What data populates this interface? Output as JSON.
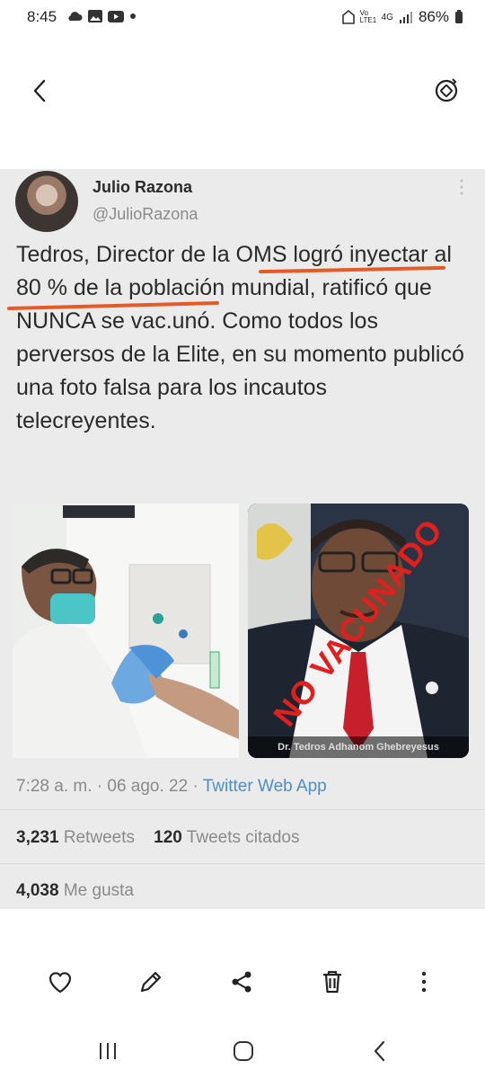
{
  "status_bar": {
    "time": "8:45",
    "network": "4G",
    "volte": "Vo LTE1",
    "battery": "86%"
  },
  "icons": {
    "back": "chevron-left-icon",
    "rotate": "rotate-icon",
    "like": "heart-icon",
    "edit": "pencil-icon",
    "share": "share-icon",
    "delete": "trash-icon",
    "more": "more-vertical-icon"
  },
  "tweet": {
    "author_name": "Julio Razona",
    "author_handle": "@JulioRazona",
    "text": "Tedros, Director de la OMS logró inyectar al 80 % de la población mundial, ratificó que NUNCA se vac.unó. Como todos los perversos de la Elite, en su momento  publicó una foto falsa para los incautos telecreyentes.",
    "photo_caption": "Dr. Tedros Adhanom Ghebreyesus",
    "stamp_text": "NO VACUNADO",
    "time": "7:28 a. m.",
    "sep1": "·",
    "date": "06 ago. 22",
    "sep2": "·",
    "source": "Twitter Web App",
    "retweets_count": "3,231",
    "retweets_label": "Retweets",
    "quotes_count": "120",
    "quotes_label": "Tweets citados",
    "likes_count": "4,038",
    "likes_label": "Me gusta"
  },
  "colors": {
    "underline": "#e35b27",
    "stamp": "#e11f1f",
    "link": "#4a8fc9"
  }
}
